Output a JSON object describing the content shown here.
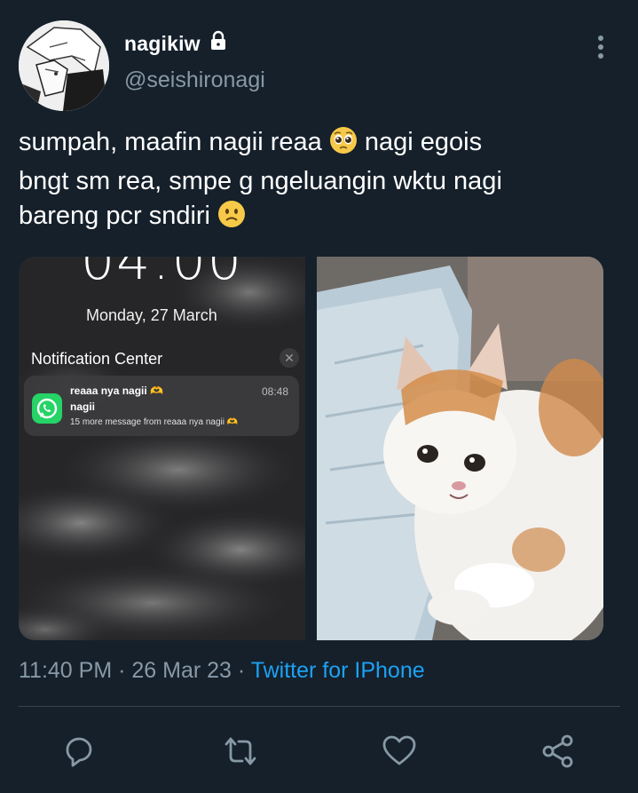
{
  "user": {
    "display_name": "nagikiw",
    "handle": "@seishironagi",
    "lock_icon": "lock-icon"
  },
  "tweet": {
    "line1_before": "sumpah, maafin nagii reaa ",
    "line1_after": " nagi egois",
    "line2": "bngt sm rea, smpe g ngeluangin wktu nagi",
    "line3_before": "bareng pcr sndiri ",
    "emoji_1": "pleading-face-emoji",
    "emoji_2": "slightly-frowning-face-emoji"
  },
  "media": {
    "left": {
      "lock_time": "04:00",
      "lock_date": "Monday, 27 March",
      "notification_center_label": "Notification Center",
      "notification": {
        "app_icon": "whatsapp-icon",
        "title": "reaaa nya nagii 🫶",
        "time": "08:48",
        "sender": "nagii",
        "body": "15 more message from reaaa nya nagii 🫶"
      }
    },
    "right": {
      "description_icon": "crying-cat-image"
    }
  },
  "meta": {
    "time": "11:40 PM",
    "separator": " · ",
    "date": "26 Mar 23",
    "source": "Twitter for IPhone"
  },
  "actions": {
    "reply": "reply-icon",
    "retweet": "retweet-icon",
    "like": "heart-icon",
    "share": "share-icon"
  },
  "colors": {
    "background": "#15202b",
    "secondary_text": "#8899a6",
    "link": "#1da1f2",
    "divider": "#38444d"
  }
}
